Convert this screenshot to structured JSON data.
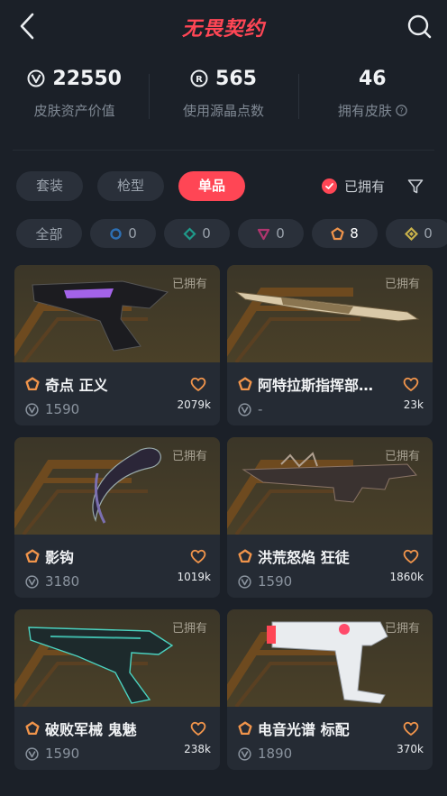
{
  "header": {
    "title": "无畏契约",
    "back_icon": "chevron-left-icon",
    "search_icon": "search-icon",
    "accent": "#ff4655"
  },
  "stats": [
    {
      "value": "22550",
      "label": "皮肤资产价值",
      "icon": "vp-coin-icon"
    },
    {
      "value": "565",
      "label": "使用源晶点数",
      "icon": "radianite-icon"
    },
    {
      "value": "46",
      "label": "拥有皮肤",
      "icon": "help-icon"
    }
  ],
  "tabs": [
    {
      "label": "套装",
      "active": false
    },
    {
      "label": "枪型",
      "active": false
    },
    {
      "label": "单品",
      "active": true
    }
  ],
  "owned_filter": {
    "label": "已拥有",
    "checked": true
  },
  "rarity_chips": [
    {
      "label": "全部"
    },
    {
      "count": "0",
      "tier": "select",
      "color": "#2d6fb3"
    },
    {
      "count": "0",
      "tier": "deluxe",
      "color": "#1f9a8a"
    },
    {
      "count": "0",
      "tier": "premium",
      "color": "#b0356e"
    },
    {
      "count": "8",
      "tier": "exclusive",
      "color": "#f0944b"
    },
    {
      "count": "0",
      "tier": "ultra",
      "color": "#c9b24a"
    }
  ],
  "items": [
    {
      "name": "奇点 正义",
      "price": "1590",
      "likes": "2079k",
      "owned": "已拥有"
    },
    {
      "name": "阿特拉斯指挥部…",
      "price": "-",
      "likes": "23k",
      "owned": "已拥有"
    },
    {
      "name": "影钩",
      "price": "3180",
      "likes": "1019k",
      "owned": "已拥有"
    },
    {
      "name": "洪荒怒焰 狂徒",
      "price": "1590",
      "likes": "1860k",
      "owned": "已拥有"
    },
    {
      "name": "破败军械 鬼魅",
      "price": "1590",
      "likes": "238k",
      "owned": "已拥有"
    },
    {
      "name": "电音光谱 标配",
      "price": "1890",
      "likes": "370k",
      "owned": "已拥有"
    }
  ]
}
